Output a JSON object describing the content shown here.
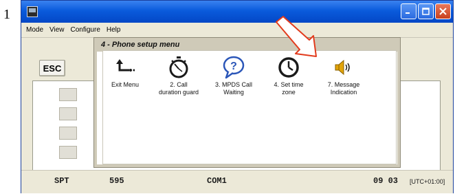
{
  "step_number": "1",
  "menubar": {
    "items": [
      "Mode",
      "View",
      "Configure",
      "Help"
    ]
  },
  "toolbar": {
    "esc_label": "ESC"
  },
  "menu_panel": {
    "title": "4 - Phone setup menu",
    "items": [
      {
        "label": "Exit Menu",
        "icon": "return-arrow-icon"
      },
      {
        "label": "2. Call\nduration guard",
        "icon": "stopwatch-icon"
      },
      {
        "label": "3. MPDS Call\nWaiting",
        "icon": "question-bubble-icon"
      },
      {
        "label": "4. Set time\nzone",
        "icon": "clock-icon"
      },
      {
        "label": "7. Message\nIndication",
        "icon": "speaker-icon"
      }
    ]
  },
  "status": {
    "spt": "SPT",
    "value": "595",
    "port": "COM1",
    "time": "09 03",
    "timezone": "[UTC+01:00]"
  },
  "colors": {
    "titlebar": "#0a5bdc",
    "arrow": "#e23a1c",
    "speaker": "#e2a40a"
  }
}
